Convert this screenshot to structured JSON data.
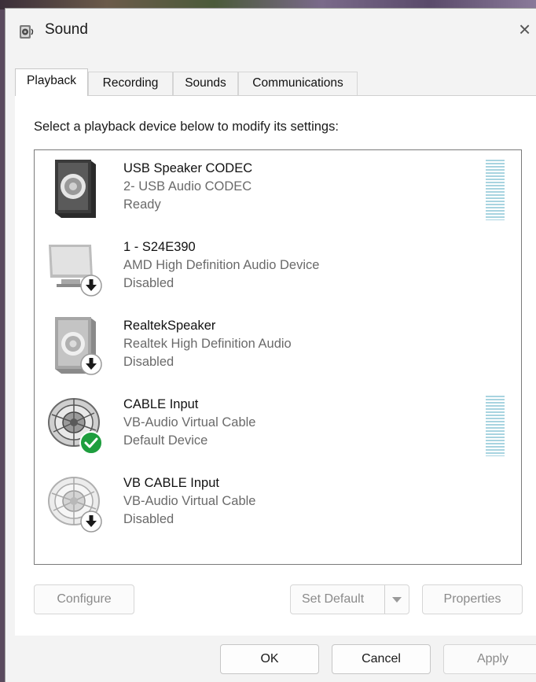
{
  "window": {
    "title": "Sound",
    "close_glyph": "×",
    "icon": "speaker-icon"
  },
  "tabs": [
    {
      "label": "Playback",
      "active": true
    },
    {
      "label": "Recording",
      "active": false
    },
    {
      "label": "Sounds",
      "active": false
    },
    {
      "label": "Communications",
      "active": false
    }
  ],
  "playback": {
    "instruction": "Select a playback device below to modify its settings:",
    "devices": [
      {
        "name": "USB Speaker CODEC",
        "description": "2- USB Audio CODEC",
        "status": "Ready",
        "icon": "speaker-box-icon",
        "badge": "none",
        "meter": true
      },
      {
        "name": "1 - S24E390",
        "description": "AMD High Definition Audio Device",
        "status": "Disabled",
        "icon": "monitor-icon",
        "badge": "disabled-arrow",
        "meter": false
      },
      {
        "name": "RealtekSpeaker",
        "description": "Realtek High Definition Audio",
        "status": "Disabled",
        "icon": "speaker-box-icon",
        "badge": "disabled-arrow",
        "meter": false
      },
      {
        "name": "CABLE Input",
        "description": "VB-Audio Virtual Cable",
        "status": "Default Device",
        "icon": "cable-speaker-icon",
        "badge": "default-check",
        "meter": true
      },
      {
        "name": "VB CABLE Input",
        "description": "VB-Audio Virtual Cable",
        "status": "Disabled",
        "icon": "cable-speaker-icon",
        "badge": "disabled-arrow",
        "meter": false
      }
    ],
    "buttons": {
      "configure": "Configure",
      "set_default": "Set Default",
      "properties": "Properties"
    }
  },
  "footer": {
    "ok": "OK",
    "cancel": "Cancel",
    "apply": "Apply"
  },
  "colors": {
    "meter": "#a8d4e0",
    "check_badge": "#1e9e3e",
    "dialog_bg": "#f3f3f3"
  }
}
